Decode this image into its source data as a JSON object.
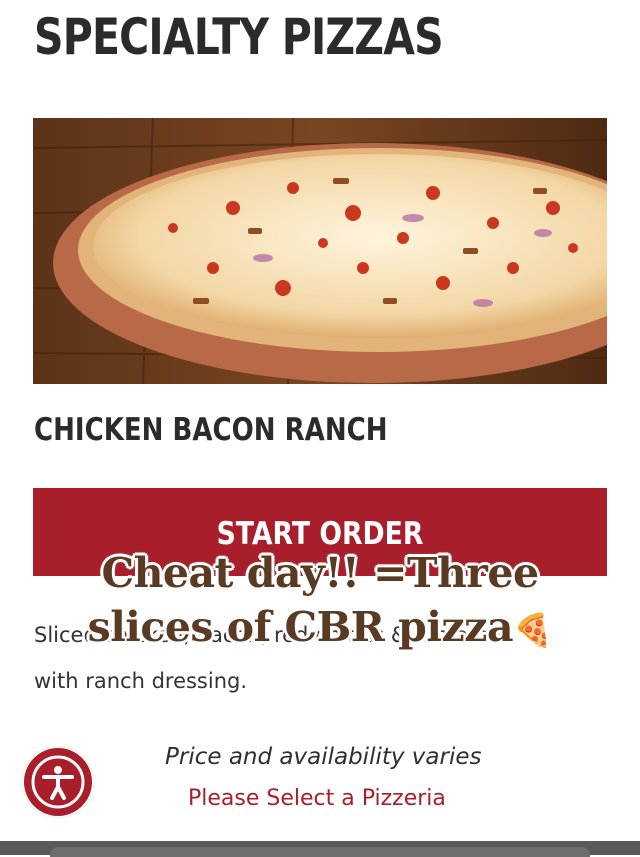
{
  "header": {
    "title": "SPECIALTY PIZZAS"
  },
  "product": {
    "name": "CHICKEN BACON RANCH",
    "image_icon": "pizza-photo",
    "start_order_label": "START ORDER",
    "description_line1": "Sliced chicken, bacon, red onions & tomatoes",
    "description_line2": "with ranch dressing."
  },
  "overlay": {
    "caption_line1": "Cheat day!! =Three",
    "caption_line2": "slices of CBR pizza",
    "emoji": "🍕"
  },
  "footer": {
    "price_note": "Price and availability varies",
    "select_pizzeria": "Please Select a Pizzeria",
    "accessibility_icon": "accessibility-person-icon"
  },
  "colors": {
    "brand_red": "#a81f2b",
    "title_text": "#2b2b2b",
    "caption_brown": "#5b3a24"
  }
}
